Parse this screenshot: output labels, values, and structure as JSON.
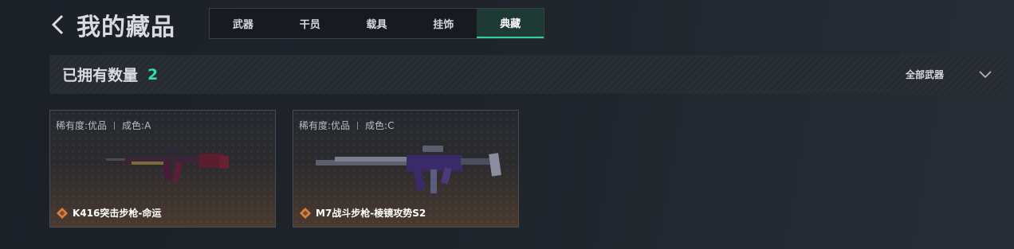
{
  "header": {
    "title": "我的藏品"
  },
  "tabs": [
    {
      "label": "武器",
      "active": false
    },
    {
      "label": "干员",
      "active": false
    },
    {
      "label": "载具",
      "active": false
    },
    {
      "label": "挂饰",
      "active": false
    },
    {
      "label": "典藏",
      "active": true
    }
  ],
  "summary": {
    "count_label": "已拥有数量",
    "count_value": "2",
    "filter_label": "全部武器"
  },
  "items": [
    {
      "rarity": "稀有度:优品",
      "grade": "成色:A",
      "name": "K416突击步枪-命运"
    },
    {
      "rarity": "稀有度:优品",
      "grade": "成色:C",
      "name": "M7战斗步枪-棱镜攻势S2"
    }
  ],
  "colors": {
    "accent": "#2fe09f",
    "active_tab": "#1f3a35",
    "rarity_icon": "#d9823f"
  }
}
